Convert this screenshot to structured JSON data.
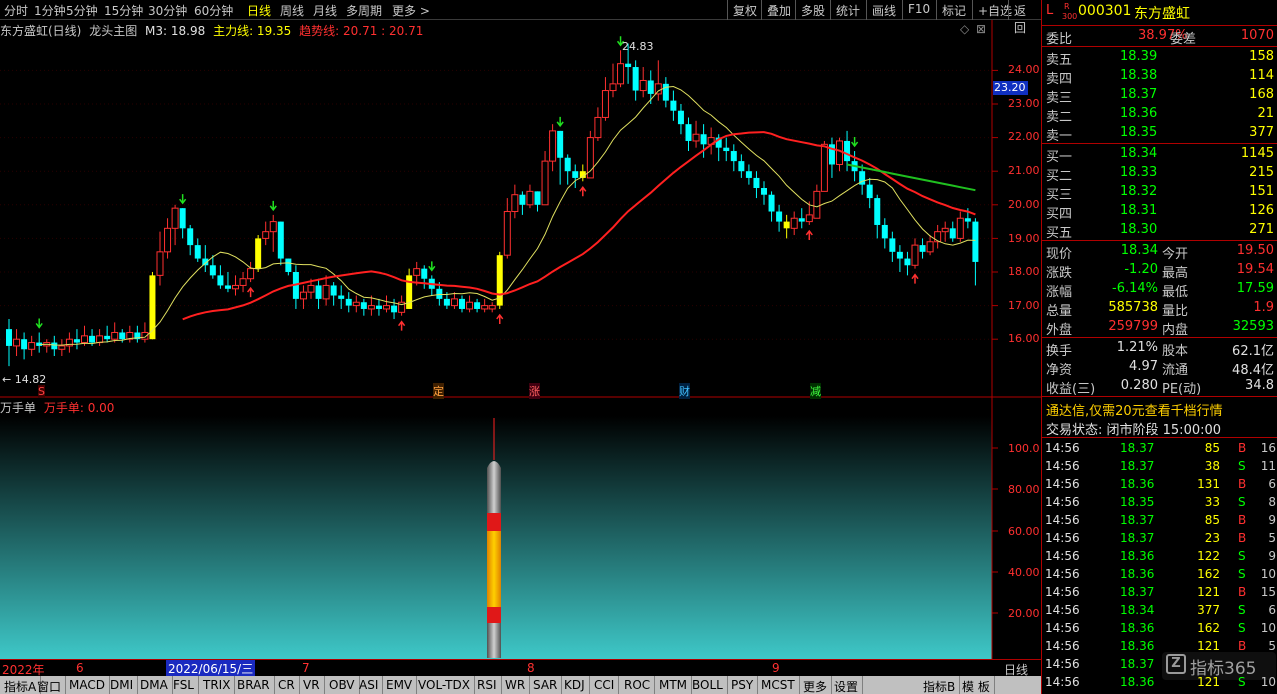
{
  "toolbar": {
    "periods": [
      "分时",
      "1分钟",
      "5分钟",
      "15分钟",
      "30分钟",
      "60分钟",
      "日线",
      "周线",
      "月线",
      "多周期",
      "更多 >"
    ],
    "active_period": "日线",
    "buttons": [
      "复权",
      "叠加",
      "多股",
      "统计",
      "画线",
      "F10",
      "标记",
      "+自选",
      "返回"
    ]
  },
  "main_header": {
    "stock": "东方盛虹(日线)",
    "indicator": "龙头主图",
    "m3": "M3: 18.98",
    "main_line": "主力线: 19.35",
    "trend_line": "趋势线: 20.71 : 20.71",
    "corner_icons": [
      "◇",
      "⊠"
    ]
  },
  "main_axis": {
    "ticks": [
      "24.00",
      "23.00",
      "22.00",
      "21.00",
      "20.00",
      "19.00",
      "18.00",
      "17.00",
      "16.00"
    ],
    "current_price_tag": "23.20",
    "high_label": "24.83",
    "low_label": "← 14.82"
  },
  "events": [
    "S",
    "定",
    "涨",
    "财",
    "减"
  ],
  "indicator_header": {
    "name": "万手单",
    "value": "万手单: 0.00"
  },
  "indicator_axis": {
    "ticks": [
      "100.0",
      "80.00",
      "60.00",
      "40.00",
      "20.00"
    ]
  },
  "date_bar": {
    "labels": [
      "2022年",
      "6",
      "2022/06/15/三",
      "7",
      "8",
      "9"
    ],
    "period": "日线"
  },
  "tabs": [
    "指标A",
    "窗口",
    "MACD",
    "DMI",
    "DMA",
    "FSL",
    "TRIX",
    "BRAR",
    "CR",
    "VR",
    "OBV",
    "ASI",
    "EMV",
    "VOL-TDX",
    "RSI",
    "WR",
    "SAR",
    "KDJ",
    "CCI",
    "ROC",
    "MTM",
    "BOLL",
    "PSY",
    "MCST",
    "更多",
    "设置",
    "指标B",
    "模 板"
  ],
  "side": {
    "markers": [
      "L",
      "R",
      "300"
    ],
    "code": "000301",
    "name": "东方盛虹",
    "weibi_label": "委比",
    "weibi_value": "38.97%",
    "weicha_label": "委差",
    "weicha_value": "1070",
    "sells": [
      {
        "label": "卖五",
        "price": "18.39",
        "vol": "158"
      },
      {
        "label": "卖四",
        "price": "18.38",
        "vol": "114"
      },
      {
        "label": "卖三",
        "price": "18.37",
        "vol": "168"
      },
      {
        "label": "卖二",
        "price": "18.36",
        "vol": "21"
      },
      {
        "label": "卖一",
        "price": "18.35",
        "vol": "377"
      }
    ],
    "buys": [
      {
        "label": "买一",
        "price": "18.34",
        "vol": "1145"
      },
      {
        "label": "买二",
        "price": "18.33",
        "vol": "215"
      },
      {
        "label": "买三",
        "price": "18.32",
        "vol": "151"
      },
      {
        "label": "买四",
        "price": "18.31",
        "vol": "126"
      },
      {
        "label": "买五",
        "price": "18.30",
        "vol": "271"
      }
    ],
    "quote": [
      {
        "l1": "现价",
        "v1": "18.34",
        "l2": "今开",
        "v2": "19.50",
        "c1": "#00ff00",
        "c2": "#ff3030"
      },
      {
        "l1": "涨跌",
        "v1": "-1.20",
        "l2": "最高",
        "v2": "19.54",
        "c1": "#00ff00",
        "c2": "#ff3030"
      },
      {
        "l1": "涨幅",
        "v1": "-6.14%",
        "l2": "最低",
        "v2": "17.59",
        "c1": "#00ff00",
        "c2": "#00ff00"
      },
      {
        "l1": "总量",
        "v1": "585738",
        "l2": "量比",
        "v2": "1.9",
        "c1": "#ffff00",
        "c2": "#ff3030"
      },
      {
        "l1": "外盘",
        "v1": "259799",
        "l2": "内盘",
        "v2": "32593",
        "c1": "#ff3030",
        "c2": "#00ff00"
      }
    ],
    "fund": [
      {
        "l1": "换手",
        "v1": "1.21%",
        "l2": "股本",
        "v2": "62.1亿"
      },
      {
        "l1": "净资",
        "v1": "4.97",
        "l2": "流通",
        "v2": "48.4亿"
      },
      {
        "l1": "收益(三)",
        "v1": "0.280",
        "l2": "PE(动)",
        "v2": "34.8"
      }
    ],
    "promo": "通达信,仅需20元查看千档行情",
    "status": "交易状态: 闭市阶段 15:00:00",
    "ticks": [
      {
        "t": "14:56",
        "p": "18.37",
        "v": "85",
        "d": "B",
        "n": "16"
      },
      {
        "t": "14:56",
        "p": "18.37",
        "v": "38",
        "d": "S",
        "n": "11"
      },
      {
        "t": "14:56",
        "p": "18.36",
        "v": "131",
        "d": "B",
        "n": "6"
      },
      {
        "t": "14:56",
        "p": "18.35",
        "v": "33",
        "d": "S",
        "n": "8"
      },
      {
        "t": "14:56",
        "p": "18.37",
        "v": "85",
        "d": "B",
        "n": "9"
      },
      {
        "t": "14:56",
        "p": "18.37",
        "v": "23",
        "d": "B",
        "n": "5"
      },
      {
        "t": "14:56",
        "p": "18.36",
        "v": "122",
        "d": "S",
        "n": "9"
      },
      {
        "t": "14:56",
        "p": "18.36",
        "v": "162",
        "d": "S",
        "n": "10"
      },
      {
        "t": "14:56",
        "p": "18.37",
        "v": "121",
        "d": "B",
        "n": "15"
      },
      {
        "t": "14:56",
        "p": "18.34",
        "v": "377",
        "d": "S",
        "n": "6"
      },
      {
        "t": "14:56",
        "p": "18.36",
        "v": "162",
        "d": "S",
        "n": "10"
      },
      {
        "t": "14:56",
        "p": "18.36",
        "v": "121",
        "d": "B",
        "n": "5"
      },
      {
        "t": "14:56",
        "p": "18.37",
        "v": "",
        "d": "",
        "n": ""
      },
      {
        "t": "14:56",
        "p": "18.36",
        "v": "121",
        "d": "S",
        "n": "10"
      }
    ],
    "watermark": "指标365"
  },
  "colors": {
    "up": "#ff3030",
    "down": "#00ffff",
    "yellow": "#ffff00",
    "ma_red": "#ff2020",
    "ma_yellow": "#e0e060",
    "ma_green": "#20c020"
  }
}
